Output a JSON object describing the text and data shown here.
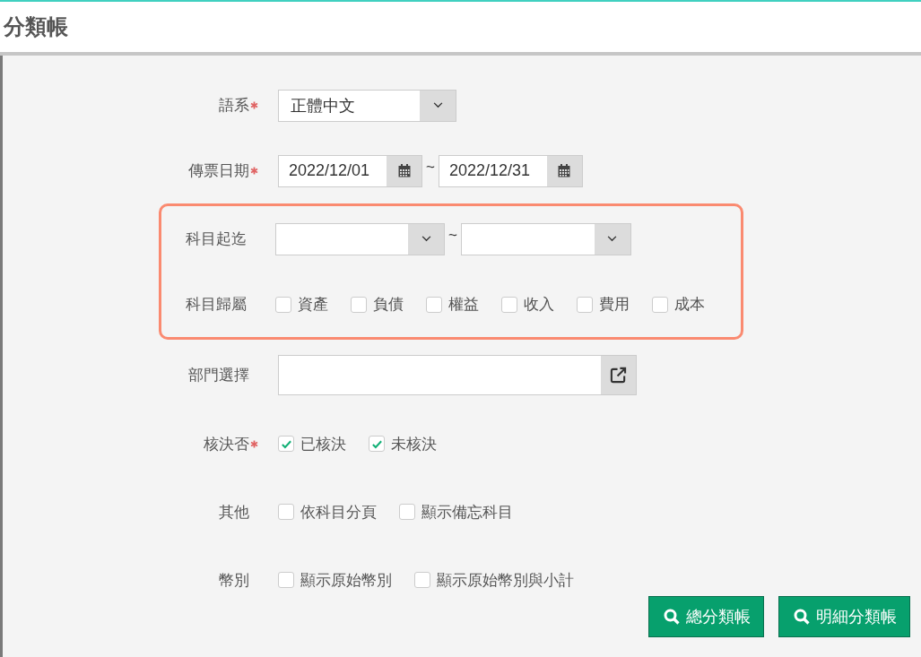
{
  "title": "分類帳",
  "fields": [
    {
      "kind": "select",
      "label": "語系",
      "required": true,
      "highlighted": false,
      "value": "正體中文"
    },
    {
      "kind": "date_range",
      "label": "傳票日期",
      "required": true,
      "highlighted": false,
      "from": "2022/12/01",
      "separator": "~",
      "to": "2022/12/31"
    },
    {
      "kind": "select_range",
      "label": "科目起迄",
      "required": false,
      "highlighted": true,
      "separator": "~"
    },
    {
      "kind": "checkboxes",
      "label": "科目歸屬",
      "required": false,
      "highlighted": true,
      "options": [
        {
          "label": "資產",
          "checked": false
        },
        {
          "label": "負債",
          "checked": false
        },
        {
          "label": "權益",
          "checked": false
        },
        {
          "label": "收入",
          "checked": false
        },
        {
          "label": "費用",
          "checked": false
        },
        {
          "label": "成本",
          "checked": false
        }
      ]
    },
    {
      "kind": "picker",
      "label": "部門選擇",
      "required": false,
      "highlighted": false
    },
    {
      "kind": "checkboxes",
      "label": "核決否",
      "required": true,
      "highlighted": false,
      "options": [
        {
          "label": "已核決",
          "checked": true
        },
        {
          "label": "未核決",
          "checked": true
        }
      ]
    },
    {
      "kind": "checkboxes",
      "label": "其他",
      "required": false,
      "highlighted": false,
      "options": [
        {
          "label": "依科目分頁",
          "checked": false
        },
        {
          "label": "顯示備忘科目",
          "checked": false
        }
      ]
    },
    {
      "kind": "checkboxes",
      "label": "幣別",
      "required": false,
      "highlighted": false,
      "options": [
        {
          "label": "顯示原始幣別",
          "checked": false
        },
        {
          "label": "顯示原始幣別與小計",
          "checked": false
        }
      ]
    }
  ],
  "buttons": [
    {
      "label": "總分類帳"
    },
    {
      "label": "明細分類帳"
    }
  ]
}
